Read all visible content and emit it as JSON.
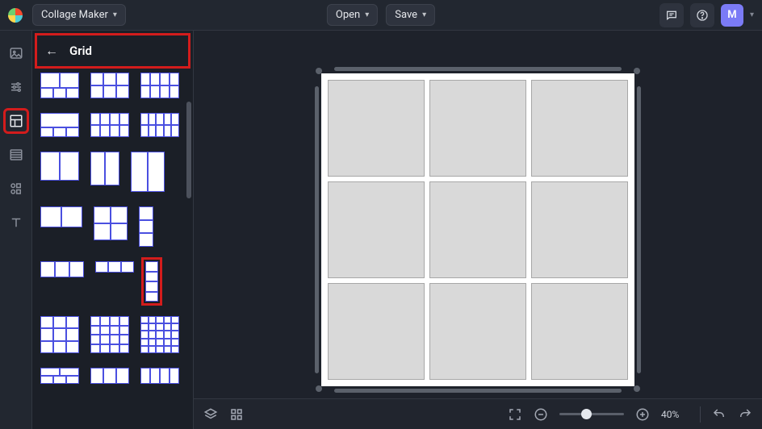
{
  "header": {
    "app_label": "Collage Maker",
    "open_label": "Open",
    "save_label": "Save",
    "avatar_initial": "M"
  },
  "panel": {
    "title": "Grid"
  },
  "zoom": {
    "level_label": "40%",
    "level_fraction": 0.4
  },
  "icons": {
    "feedback": "feedback",
    "help": "help"
  }
}
